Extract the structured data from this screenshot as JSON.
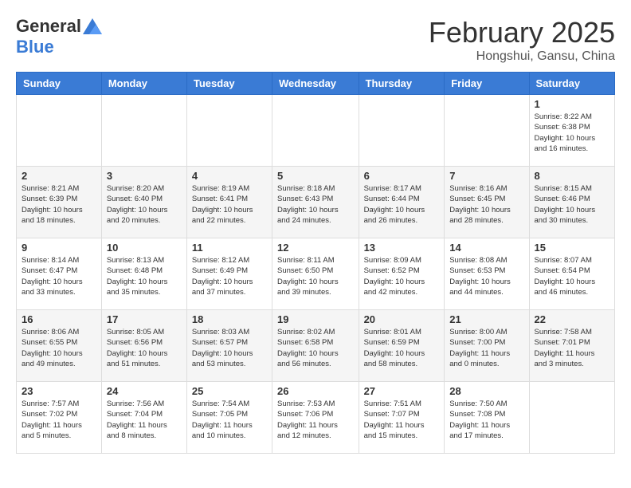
{
  "header": {
    "logo_general": "General",
    "logo_blue": "Blue",
    "month_title": "February 2025",
    "location": "Hongshui, Gansu, China"
  },
  "weekdays": [
    "Sunday",
    "Monday",
    "Tuesday",
    "Wednesday",
    "Thursday",
    "Friday",
    "Saturday"
  ],
  "weeks": [
    [
      {
        "day": "",
        "info": ""
      },
      {
        "day": "",
        "info": ""
      },
      {
        "day": "",
        "info": ""
      },
      {
        "day": "",
        "info": ""
      },
      {
        "day": "",
        "info": ""
      },
      {
        "day": "",
        "info": ""
      },
      {
        "day": "1",
        "info": "Sunrise: 8:22 AM\nSunset: 6:38 PM\nDaylight: 10 hours\nand 16 minutes."
      }
    ],
    [
      {
        "day": "2",
        "info": "Sunrise: 8:21 AM\nSunset: 6:39 PM\nDaylight: 10 hours\nand 18 minutes."
      },
      {
        "day": "3",
        "info": "Sunrise: 8:20 AM\nSunset: 6:40 PM\nDaylight: 10 hours\nand 20 minutes."
      },
      {
        "day": "4",
        "info": "Sunrise: 8:19 AM\nSunset: 6:41 PM\nDaylight: 10 hours\nand 22 minutes."
      },
      {
        "day": "5",
        "info": "Sunrise: 8:18 AM\nSunset: 6:43 PM\nDaylight: 10 hours\nand 24 minutes."
      },
      {
        "day": "6",
        "info": "Sunrise: 8:17 AM\nSunset: 6:44 PM\nDaylight: 10 hours\nand 26 minutes."
      },
      {
        "day": "7",
        "info": "Sunrise: 8:16 AM\nSunset: 6:45 PM\nDaylight: 10 hours\nand 28 minutes."
      },
      {
        "day": "8",
        "info": "Sunrise: 8:15 AM\nSunset: 6:46 PM\nDaylight: 10 hours\nand 30 minutes."
      }
    ],
    [
      {
        "day": "9",
        "info": "Sunrise: 8:14 AM\nSunset: 6:47 PM\nDaylight: 10 hours\nand 33 minutes."
      },
      {
        "day": "10",
        "info": "Sunrise: 8:13 AM\nSunset: 6:48 PM\nDaylight: 10 hours\nand 35 minutes."
      },
      {
        "day": "11",
        "info": "Sunrise: 8:12 AM\nSunset: 6:49 PM\nDaylight: 10 hours\nand 37 minutes."
      },
      {
        "day": "12",
        "info": "Sunrise: 8:11 AM\nSunset: 6:50 PM\nDaylight: 10 hours\nand 39 minutes."
      },
      {
        "day": "13",
        "info": "Sunrise: 8:09 AM\nSunset: 6:52 PM\nDaylight: 10 hours\nand 42 minutes."
      },
      {
        "day": "14",
        "info": "Sunrise: 8:08 AM\nSunset: 6:53 PM\nDaylight: 10 hours\nand 44 minutes."
      },
      {
        "day": "15",
        "info": "Sunrise: 8:07 AM\nSunset: 6:54 PM\nDaylight: 10 hours\nand 46 minutes."
      }
    ],
    [
      {
        "day": "16",
        "info": "Sunrise: 8:06 AM\nSunset: 6:55 PM\nDaylight: 10 hours\nand 49 minutes."
      },
      {
        "day": "17",
        "info": "Sunrise: 8:05 AM\nSunset: 6:56 PM\nDaylight: 10 hours\nand 51 minutes."
      },
      {
        "day": "18",
        "info": "Sunrise: 8:03 AM\nSunset: 6:57 PM\nDaylight: 10 hours\nand 53 minutes."
      },
      {
        "day": "19",
        "info": "Sunrise: 8:02 AM\nSunset: 6:58 PM\nDaylight: 10 hours\nand 56 minutes."
      },
      {
        "day": "20",
        "info": "Sunrise: 8:01 AM\nSunset: 6:59 PM\nDaylight: 10 hours\nand 58 minutes."
      },
      {
        "day": "21",
        "info": "Sunrise: 8:00 AM\nSunset: 7:00 PM\nDaylight: 11 hours\nand 0 minutes."
      },
      {
        "day": "22",
        "info": "Sunrise: 7:58 AM\nSunset: 7:01 PM\nDaylight: 11 hours\nand 3 minutes."
      }
    ],
    [
      {
        "day": "23",
        "info": "Sunrise: 7:57 AM\nSunset: 7:02 PM\nDaylight: 11 hours\nand 5 minutes."
      },
      {
        "day": "24",
        "info": "Sunrise: 7:56 AM\nSunset: 7:04 PM\nDaylight: 11 hours\nand 8 minutes."
      },
      {
        "day": "25",
        "info": "Sunrise: 7:54 AM\nSunset: 7:05 PM\nDaylight: 11 hours\nand 10 minutes."
      },
      {
        "day": "26",
        "info": "Sunrise: 7:53 AM\nSunset: 7:06 PM\nDaylight: 11 hours\nand 12 minutes."
      },
      {
        "day": "27",
        "info": "Sunrise: 7:51 AM\nSunset: 7:07 PM\nDaylight: 11 hours\nand 15 minutes."
      },
      {
        "day": "28",
        "info": "Sunrise: 7:50 AM\nSunset: 7:08 PM\nDaylight: 11 hours\nand 17 minutes."
      },
      {
        "day": "",
        "info": ""
      }
    ]
  ]
}
